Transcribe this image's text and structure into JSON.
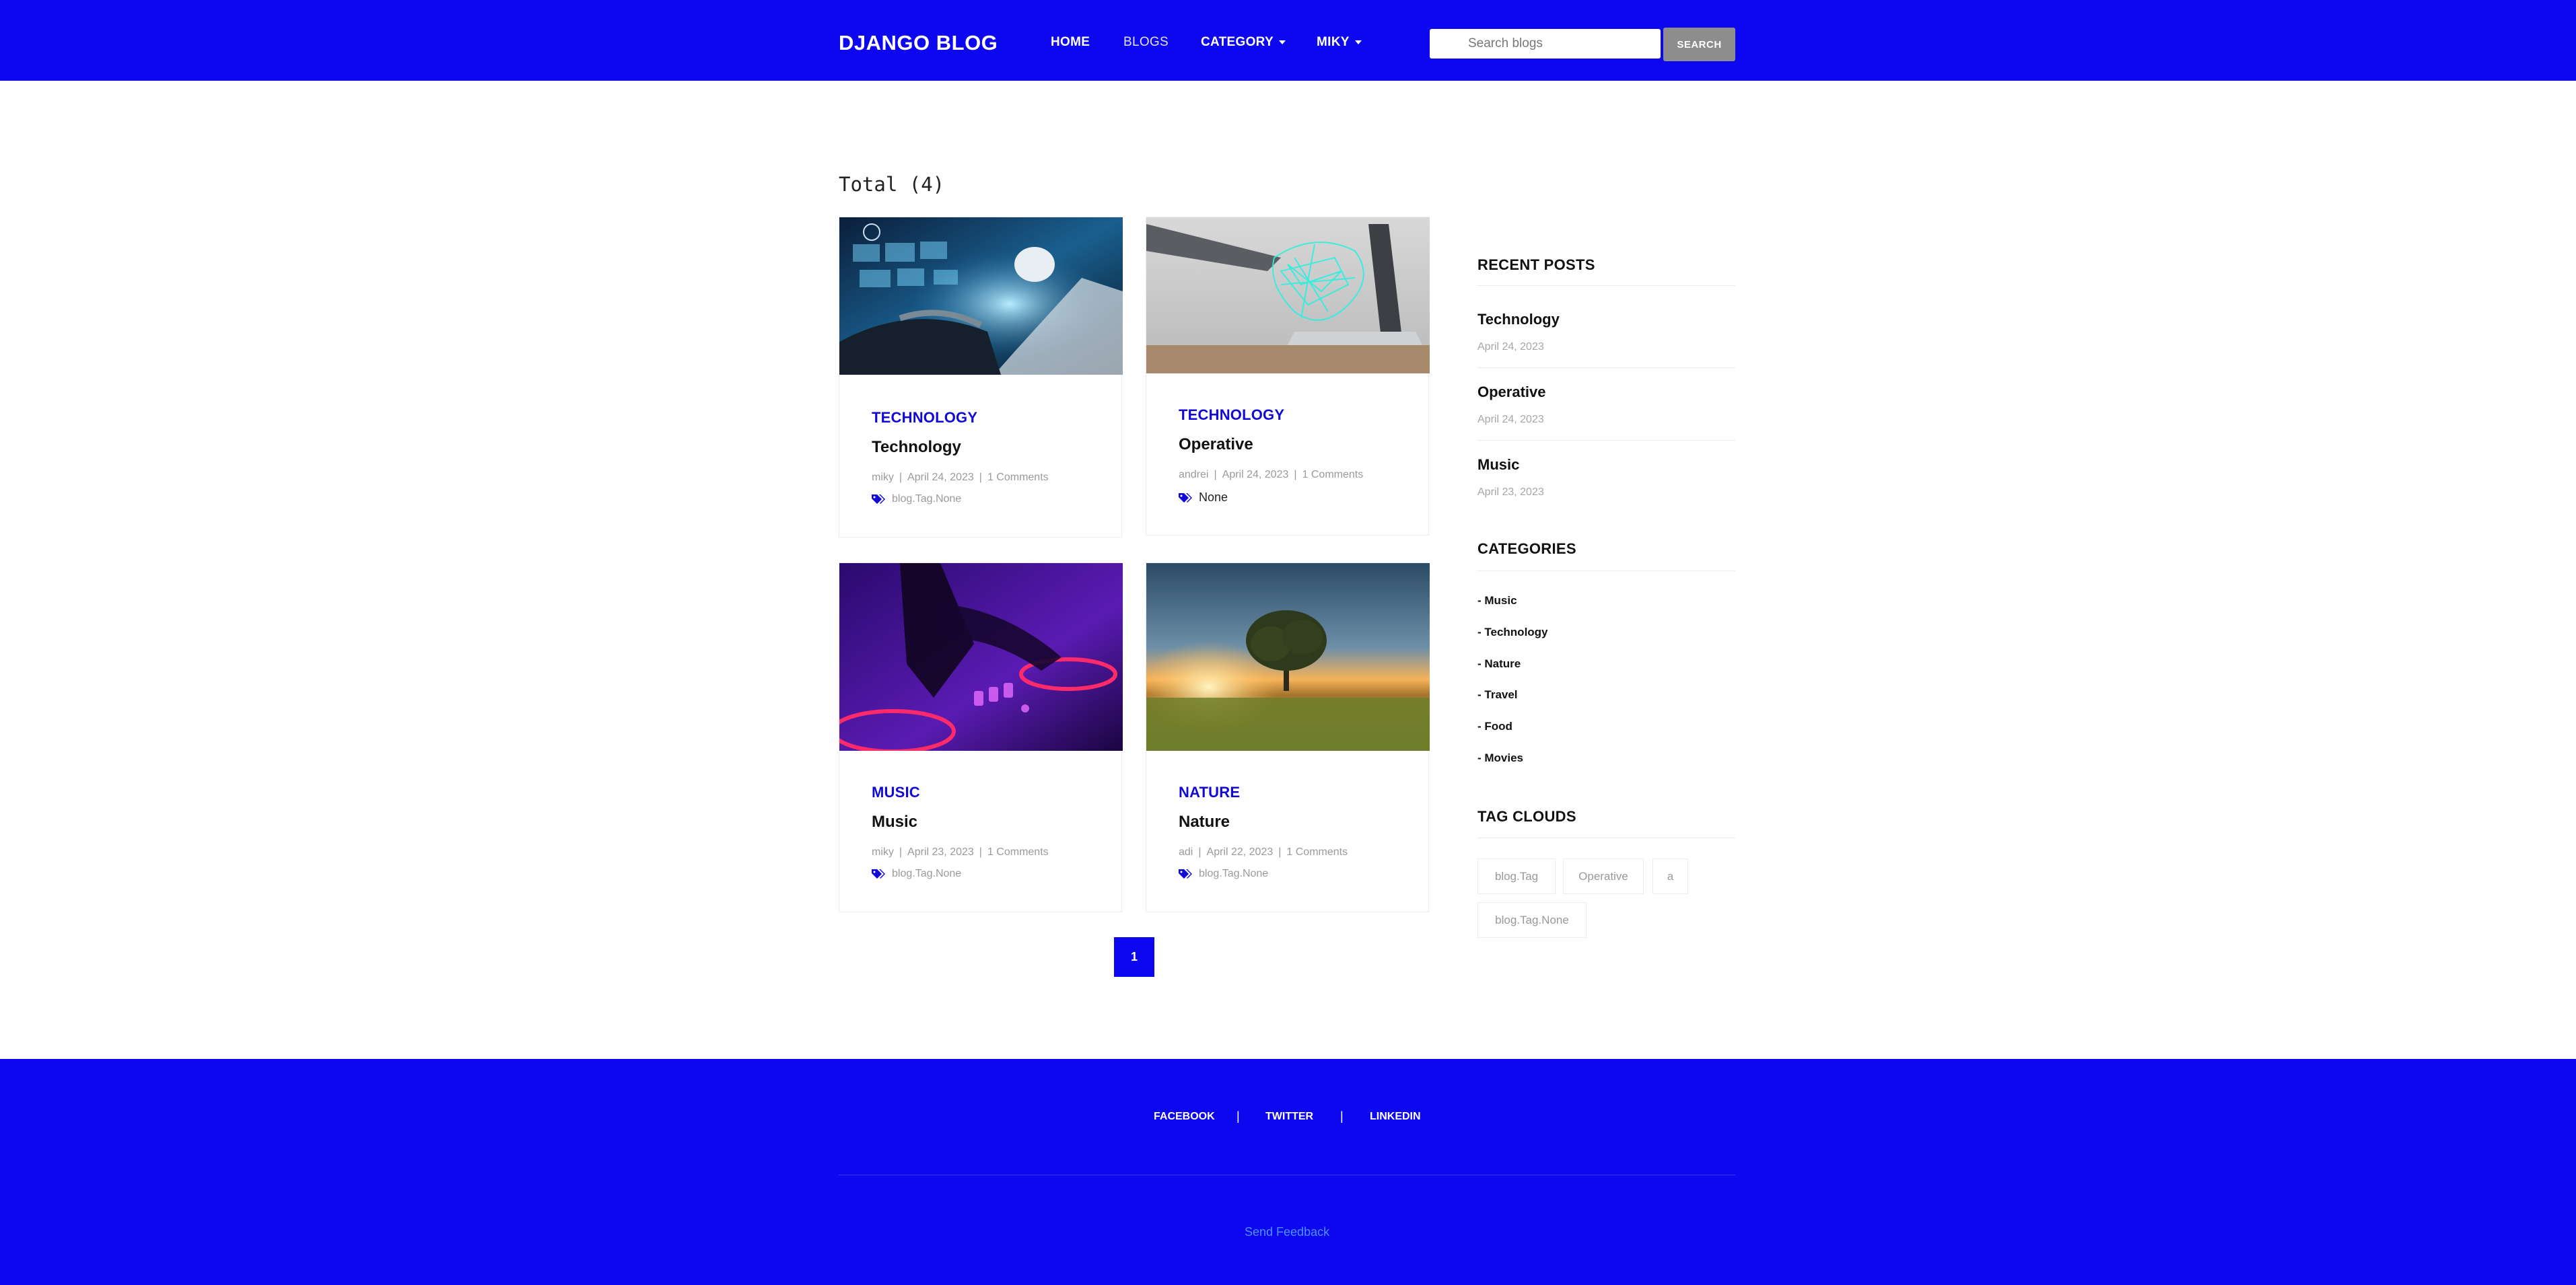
{
  "navbar": {
    "brand": "DJANGO BLOG",
    "links": [
      {
        "label": "HOME"
      },
      {
        "label": "BLOGS"
      },
      {
        "label": "CATEGORY"
      },
      {
        "label": "MIKY"
      }
    ],
    "search_placeholder": "Search blogs",
    "search_value": "",
    "search_button": "SEARCH"
  },
  "main": {
    "total_label": "Total (4)",
    "posts": [
      {
        "category": "TECHNOLOGY",
        "title": "Technology",
        "author": "miky",
        "date": "April 24, 2023",
        "comments": "1 Comments",
        "tags": "blog.Tag.None"
      },
      {
        "category": "TECHNOLOGY",
        "title": "Operative",
        "author": "andrei",
        "date": "April 24, 2023",
        "comments": "1 Comments",
        "tags": "None"
      },
      {
        "category": "MUSIC",
        "title": "Music",
        "author": "miky",
        "date": "April 23, 2023",
        "comments": "1 Comments",
        "tags": "blog.Tag.None"
      },
      {
        "category": "NATURE",
        "title": "Nature",
        "author": "adi",
        "date": "April 22, 2023",
        "comments": "1 Comments",
        "tags": "blog.Tag.None"
      }
    ],
    "meta_separator": "|",
    "pagination": {
      "current_page": "1"
    }
  },
  "sidebar": {
    "recent_heading": "RECENT POSTS",
    "recent_posts": [
      {
        "title": "Technology",
        "date": "April 24, 2023"
      },
      {
        "title": "Operative",
        "date": "April 24, 2023"
      },
      {
        "title": "Music",
        "date": "April 23, 2023"
      }
    ],
    "categories_heading": "CATEGORIES",
    "categories": [
      "- Music",
      "- Technology",
      "- Nature",
      "- Travel",
      "- Food",
      "- Movies"
    ],
    "tags_heading": "TAG CLOUDS",
    "tags": [
      "blog.Tag",
      "Operative",
      "a",
      "blog.Tag.None"
    ]
  },
  "footer": {
    "links": [
      "FACEBOOK",
      "TWITTER",
      "LINKEDIN"
    ],
    "separator": "|",
    "feedback": "Send Feedback"
  },
  "colors": {
    "brand_blue": "#0d07ef",
    "category_blue": "#1109d6",
    "search_button_gray": "#8d8d8d",
    "feedback_link": "#4f90ff"
  },
  "icons": [
    "caret-down-icon",
    "tag-icon"
  ]
}
